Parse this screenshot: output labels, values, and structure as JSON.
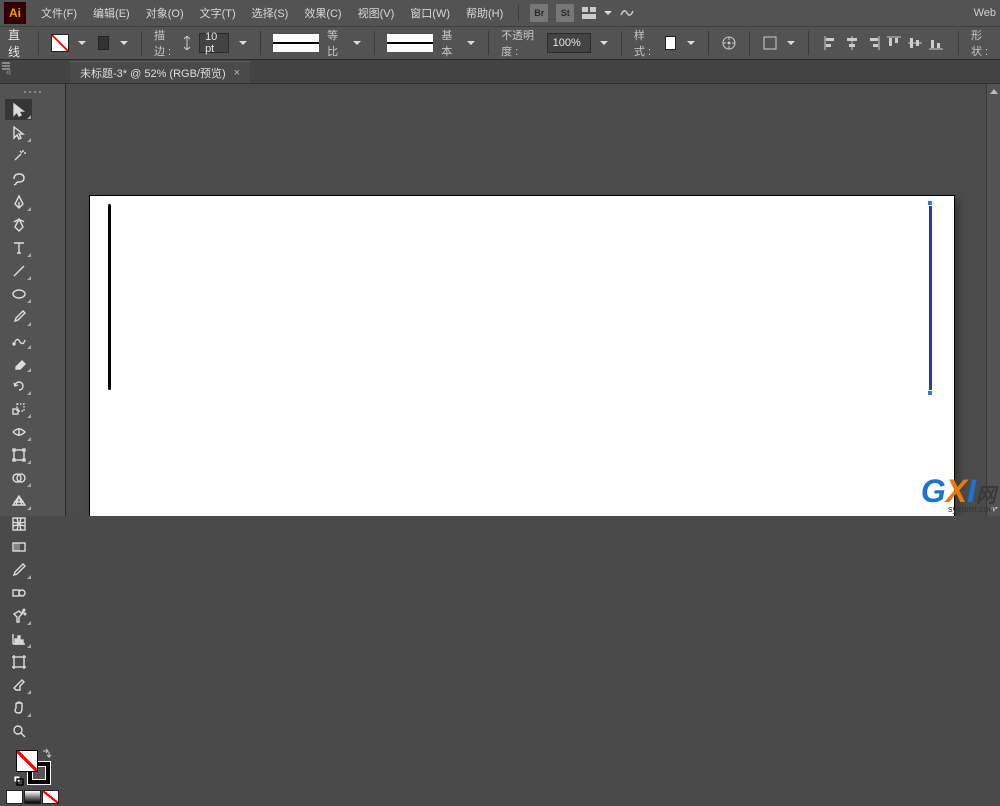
{
  "app": {
    "icon_text": "Ai"
  },
  "menu": {
    "items": [
      {
        "label": "文件(F)"
      },
      {
        "label": "编辑(E)"
      },
      {
        "label": "对象(O)"
      },
      {
        "label": "文字(T)"
      },
      {
        "label": "选择(S)"
      },
      {
        "label": "效果(C)"
      },
      {
        "label": "视图(V)"
      },
      {
        "label": "窗口(W)"
      },
      {
        "label": "帮助(H)"
      }
    ],
    "br_label": "Br",
    "st_label": "St",
    "workspace": "Web"
  },
  "control": {
    "tool_label": "直线",
    "stroke_label": "描边 :",
    "stroke_weight": "10 pt",
    "profile_label": "等比",
    "brush_label": "基本",
    "opacity_label": "不透明度 :",
    "opacity_value": "100%",
    "style_label": "样式 :",
    "shape_label": "形状 :"
  },
  "tab": {
    "title": "未标题-3* @ 52% (RGB/预览)",
    "close": "×"
  },
  "watermark": {
    "g": "G",
    "x": "X",
    "i": "I",
    "net": "网",
    "sub": "system.com"
  }
}
